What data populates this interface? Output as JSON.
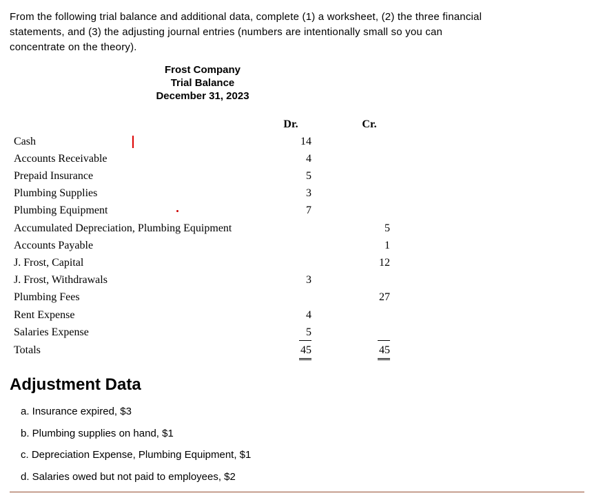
{
  "intro": {
    "l1": "From the following trial balance and additional data, complete (1) a worksheet, (2) the three financial",
    "l2": "statements, and (3) the adjusting journal entries (numbers are intentionally small so you can",
    "l3": "concentrate on the theory)."
  },
  "tb_header": {
    "company": "Frost Company",
    "title": "Trial Balance",
    "date": "December 31, 2023"
  },
  "cols": {
    "dr": "Dr.",
    "cr": "Cr."
  },
  "rows": [
    {
      "label": "Cash",
      "dr": "14",
      "cr": ""
    },
    {
      "label": "Accounts Receivable",
      "dr": "4",
      "cr": ""
    },
    {
      "label": "Prepaid Insurance",
      "dr": "5",
      "cr": ""
    },
    {
      "label": "Plumbing Supplies",
      "dr": "3",
      "cr": ""
    },
    {
      "label": "Plumbing Equipment",
      "dr": "7",
      "cr": ""
    },
    {
      "label": "Accumulated Depreciation, Plumbing Equipment",
      "dr": "",
      "cr": "5"
    },
    {
      "label": "Accounts Payable",
      "dr": "",
      "cr": "1"
    },
    {
      "label": "J. Frost, Capital",
      "dr": "",
      "cr": "12"
    },
    {
      "label": "J. Frost, Withdrawals",
      "dr": "3",
      "cr": ""
    },
    {
      "label": "Plumbing Fees",
      "dr": "",
      "cr": "27"
    },
    {
      "label": "Rent Expense",
      "dr": "4",
      "cr": ""
    },
    {
      "label": "Salaries Expense",
      "dr": "5",
      "cr": ""
    }
  ],
  "totals": {
    "label": "Totals",
    "dr": "45",
    "cr": "45"
  },
  "adj_heading": "Adjustment Data",
  "adj": {
    "a": "a. Insurance expired, $3",
    "b": "b. Plumbing supplies on hand, $1",
    "c": "c. Depreciation Expense, Plumbing Equipment, $1",
    "d": "d. Salaries owed but not paid to employees, $2"
  }
}
